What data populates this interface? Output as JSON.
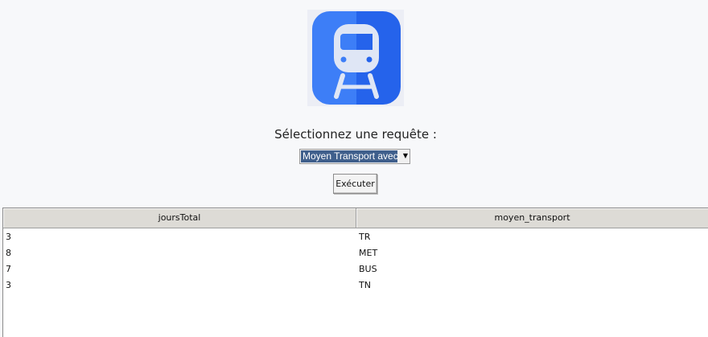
{
  "prompt": {
    "label": "Sélectionnez une requête :"
  },
  "query_select": {
    "selected": "Moyen Transport avec"
  },
  "execute_button": {
    "label": "Exécuter"
  },
  "logo": {
    "icon": "train-icon",
    "colors": {
      "primary": "#3d7ef7",
      "primary_dark": "#2563eb",
      "light": "#dfe6f5",
      "background": "#eceef5"
    }
  },
  "table": {
    "columns": [
      "joursTotal",
      "moyen_transport"
    ],
    "rows": [
      [
        "3",
        "TR"
      ],
      [
        "8",
        "MET"
      ],
      [
        "7",
        "BUS"
      ],
      [
        "3",
        "TN"
      ]
    ]
  }
}
